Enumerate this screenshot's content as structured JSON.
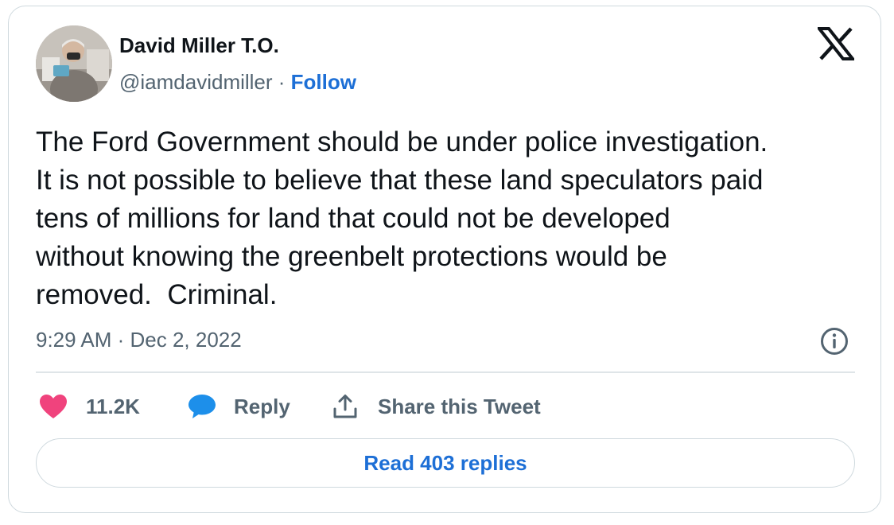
{
  "author": {
    "display_name": "David Miller T.O.",
    "handle": "@iamdavidmiller",
    "separator": " · ",
    "follow_label": "Follow"
  },
  "tweet": {
    "text_lines": [
      "The Ford Government should be under police investigation.",
      "It is not possible to believe that these land speculators paid",
      "tens of millions for land that could not be developed",
      "without knowing the greenbelt protections would be",
      "removed.  Criminal."
    ],
    "timestamp": "9:29 AM · Dec 2, 2022"
  },
  "actions": {
    "like_count": "11.2K",
    "reply_label": "Reply",
    "share_label": "Share this Tweet"
  },
  "read_replies_label": "Read 403 replies",
  "icons": {
    "logo": "x-logo-icon",
    "info": "info-icon",
    "like": "heart-icon",
    "reply": "speech-bubble-icon",
    "share": "share-upload-icon"
  },
  "colors": {
    "link": "#1d6fd6",
    "like": "#f0437d",
    "reply": "#1d8fea",
    "muted": "#536471",
    "text": "#0f1419",
    "border": "#cfd9de"
  }
}
